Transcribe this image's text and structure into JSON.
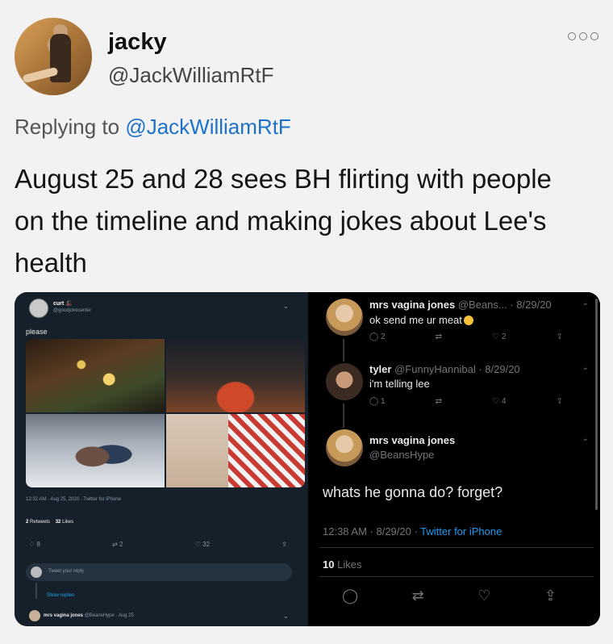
{
  "author": {
    "display_name": "jacky",
    "handle": "@JackWilliamRtF"
  },
  "reply_context": {
    "prefix": "Replying to",
    "mention": "@JackWilliamRtF"
  },
  "tweet": {
    "text": "August 25 and 28 sees BH flirting with people on the timeline and making jokes about Lee's health"
  },
  "left_screenshot": {
    "name": "curt 🎩",
    "handle": "@goodjokecenter",
    "text": "please",
    "meta": "12:32 AM · Aug 25, 2020 · Twitter for iPhone",
    "retweets_count": "2",
    "retweets_label": "Retweets",
    "likes_count": "32",
    "likes_label": "Likes",
    "action_reply": "♢ 8",
    "action_retweet": "⇄ 2",
    "action_like": "♡ 32",
    "action_share": "⇪",
    "reply_placeholder": "Tweet your reply",
    "show_replies": "Show replies",
    "last_reply_name": "mrs vagina jones",
    "last_reply_meta": "@BeansHype · Aug 25"
  },
  "right_screenshot": {
    "reply1": {
      "name": "mrs vagina jones",
      "meta": "@Beans... · 8/29/20",
      "text": "ok send me ur meat",
      "replies": "2",
      "likes": "2"
    },
    "reply2": {
      "name": "tyler",
      "meta": "@FunnyHannibal · 8/29/20",
      "text": "i'm telling lee",
      "replies": "1",
      "likes": "4"
    },
    "main": {
      "name": "mrs vagina jones",
      "handle": "@BeansHype",
      "text": "whats he gonna do? forget?",
      "time": "12:38 AM · 8/29/20 · ",
      "source": "Twitter for iPhone",
      "likes_count": "10",
      "likes_label": "Likes"
    }
  }
}
